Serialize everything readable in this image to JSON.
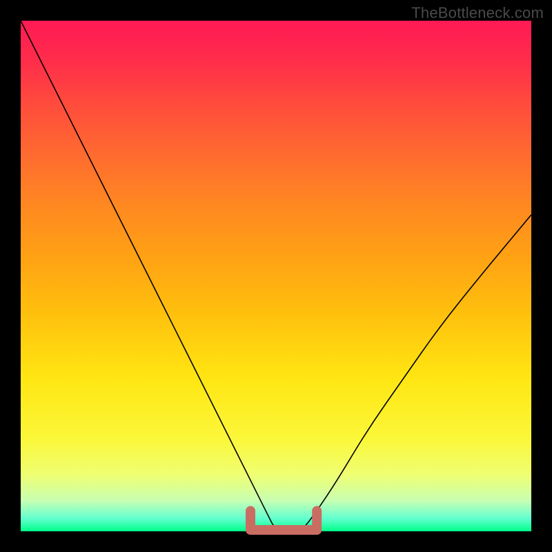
{
  "watermark": "TheBottleneck.com",
  "chart_data": {
    "type": "line",
    "title": "",
    "xlabel": "",
    "ylabel": "",
    "xlim": [
      0,
      100
    ],
    "ylim": [
      0,
      100
    ],
    "grid": false,
    "legend": false,
    "series": [
      {
        "name": "bottleneck-curve",
        "x": [
          0,
          5,
          10,
          15,
          20,
          25,
          30,
          35,
          40,
          45,
          48,
          50,
          52,
          55,
          58,
          62,
          68,
          75,
          82,
          90,
          100
        ],
        "values": [
          100,
          90,
          80,
          70,
          60,
          50,
          40,
          30,
          20,
          10,
          4,
          0,
          0,
          0,
          4,
          10,
          20,
          30,
          40,
          50,
          62
        ]
      }
    ],
    "annotations": [
      {
        "name": "optimal-range-marker",
        "color": "#c96d63",
        "x_range": [
          45,
          58
        ],
        "y_range": [
          0,
          4
        ]
      }
    ]
  }
}
